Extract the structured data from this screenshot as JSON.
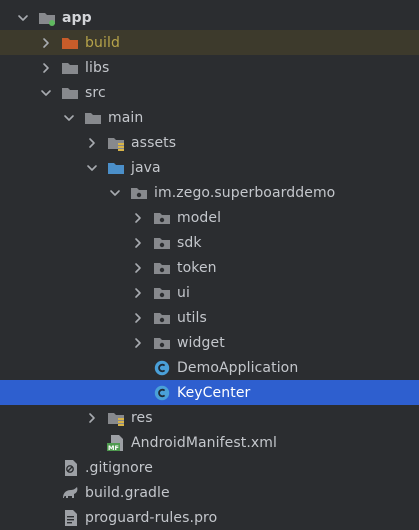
{
  "tree": [
    {
      "label": "app",
      "depth": 0,
      "state": "expanded",
      "icon": "module-folder-icon",
      "bold": true
    },
    {
      "label": "build",
      "depth": 1,
      "state": "collapsed",
      "icon": "excluded-folder-icon",
      "style": "build"
    },
    {
      "label": "libs",
      "depth": 1,
      "state": "collapsed",
      "icon": "folder-icon"
    },
    {
      "label": "src",
      "depth": 1,
      "state": "expanded",
      "icon": "folder-icon"
    },
    {
      "label": "main",
      "depth": 2,
      "state": "expanded",
      "icon": "folder-icon"
    },
    {
      "label": "assets",
      "depth": 3,
      "state": "collapsed",
      "icon": "resources-folder-icon"
    },
    {
      "label": "java",
      "depth": 3,
      "state": "expanded",
      "icon": "source-folder-icon"
    },
    {
      "label": "im.zego.superboarddemo",
      "depth": 4,
      "state": "expanded",
      "icon": "package-icon"
    },
    {
      "label": "model",
      "depth": 5,
      "state": "collapsed",
      "icon": "package-icon"
    },
    {
      "label": "sdk",
      "depth": 5,
      "state": "collapsed",
      "icon": "package-icon"
    },
    {
      "label": "token",
      "depth": 5,
      "state": "collapsed",
      "icon": "package-icon"
    },
    {
      "label": "ui",
      "depth": 5,
      "state": "collapsed",
      "icon": "package-icon"
    },
    {
      "label": "utils",
      "depth": 5,
      "state": "collapsed",
      "icon": "package-icon"
    },
    {
      "label": "widget",
      "depth": 5,
      "state": "collapsed",
      "icon": "package-icon"
    },
    {
      "label": "DemoApplication",
      "depth": 5,
      "state": "leaf",
      "icon": "java-class-icon"
    },
    {
      "label": "KeyCenter",
      "depth": 5,
      "state": "leaf",
      "icon": "java-class-icon",
      "selected": true
    },
    {
      "label": "res",
      "depth": 3,
      "state": "collapsed",
      "icon": "resources-folder-icon"
    },
    {
      "label": "AndroidManifest.xml",
      "depth": 3,
      "state": "leaf",
      "icon": "manifest-file-icon"
    },
    {
      "label": ".gitignore",
      "depth": 1,
      "state": "leaf",
      "icon": "gitignore-file-icon"
    },
    {
      "label": "build.gradle",
      "depth": 1,
      "state": "leaf",
      "icon": "gradle-file-icon"
    },
    {
      "label": "proguard-rules.pro",
      "depth": 1,
      "state": "leaf",
      "icon": "text-file-icon"
    }
  ],
  "colors": {
    "background": "#2b2d30",
    "selection": "#2e5fcf",
    "build_highlight": "#3d3a2c",
    "folder": "#87898d",
    "excluded_folder": "#c75c2a",
    "source_folder": "#4b8fc9",
    "class_icon": "#4aa0d8"
  },
  "icon_text": {
    "manifest_badge": "MF"
  }
}
